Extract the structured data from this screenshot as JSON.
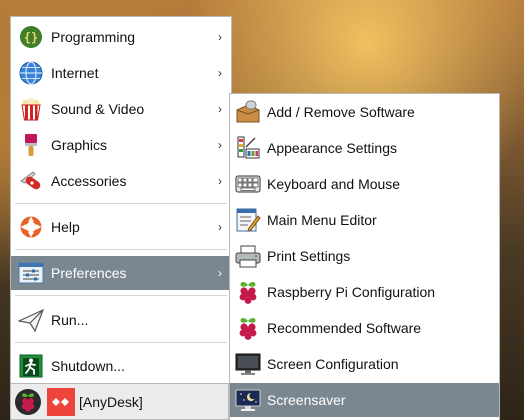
{
  "main_menu": {
    "items": [
      {
        "label": "Programming",
        "icon": "programming-icon"
      },
      {
        "label": "Internet",
        "icon": "internet-globe-icon"
      },
      {
        "label": "Sound & Video",
        "icon": "popcorn-icon"
      },
      {
        "label": "Graphics",
        "icon": "paintbrush-icon"
      },
      {
        "label": "Accessories",
        "icon": "pocketknife-icon"
      },
      {
        "label": "Help",
        "icon": "lifebuoy-icon"
      },
      {
        "label": "Preferences",
        "icon": "preferences-icon"
      },
      {
        "label": "Run...",
        "icon": "paper-plane-icon"
      },
      {
        "label": "Shutdown...",
        "icon": "exit-icon"
      }
    ],
    "submenu_arrow": "›",
    "selected": "Preferences"
  },
  "preferences_menu": {
    "items": [
      {
        "label": "Add / Remove Software",
        "icon": "package-icon"
      },
      {
        "label": "Appearance Settings",
        "icon": "appearance-icon"
      },
      {
        "label": "Keyboard and Mouse",
        "icon": "keyboard-icon"
      },
      {
        "label": "Main Menu Editor",
        "icon": "menu-editor-icon"
      },
      {
        "label": "Print Settings",
        "icon": "printer-icon"
      },
      {
        "label": "Raspberry Pi Configuration",
        "icon": "raspberry-icon"
      },
      {
        "label": "Recommended Software",
        "icon": "raspberry-icon"
      },
      {
        "label": "Screen Configuration",
        "icon": "monitor-icon"
      },
      {
        "label": "Screensaver",
        "icon": "screensaver-icon"
      }
    ],
    "selected": "Screensaver"
  },
  "taskbar": {
    "start_icon": "raspberry-icon",
    "app_label": "[AnyDesk]",
    "app_icon": "anydesk-icon"
  },
  "colors": {
    "selection": "#7b8790",
    "menu_bg": "#ffffff",
    "raspberry": "#c51a4a",
    "anydesk": "#ef443b"
  }
}
